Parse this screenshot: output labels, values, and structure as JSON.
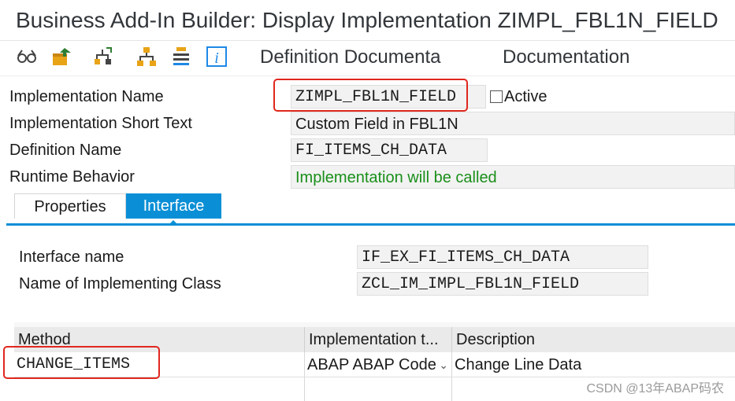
{
  "window": {
    "title": "Business Add-In Builder: Display Implementation ZIMPL_FBL1N_FIELD"
  },
  "toolbar": {
    "icons": [
      "glasses-icon",
      "transport-icon",
      "hierarchy-icon",
      "tree-icon",
      "list-icon",
      "info-icon"
    ],
    "definition_doc_label": "Definition Documenta",
    "documentation_label": "Documentation"
  },
  "header": {
    "impl_name_label": "Implementation Name",
    "impl_name_value": "ZIMPL_FBL1N_FIELD",
    "active_label": "Active",
    "short_text_label": "Implementation Short Text",
    "short_text_value": "Custom Field in FBL1N",
    "def_name_label": "Definition Name",
    "def_name_value": "FI_ITEMS_CH_DATA",
    "runtime_label": "Runtime Behavior",
    "runtime_value": "Implementation will be called",
    "runtime_color": "#1a8f1a"
  },
  "tabs": {
    "properties": "Properties",
    "interface": "Interface",
    "active_tab": "Interface",
    "accent": "#0a8fd6"
  },
  "interface": {
    "name_label": "Interface name",
    "name_value": "IF_EX_FI_ITEMS_CH_DATA",
    "class_label": "Name of Implementing Class",
    "class_value": "ZCL_IM_IMPL_FBL1N_FIELD"
  },
  "methods": {
    "columns": [
      "Method",
      "Implementation t...",
      "Description"
    ],
    "rows": [
      {
        "method": "CHANGE_ITEMS",
        "impl_type": "ABAP ABAP Code",
        "description": "Change Line Data"
      }
    ]
  },
  "highlight_color": "#e0271e",
  "watermark": "CSDN @13年ABAP码农"
}
